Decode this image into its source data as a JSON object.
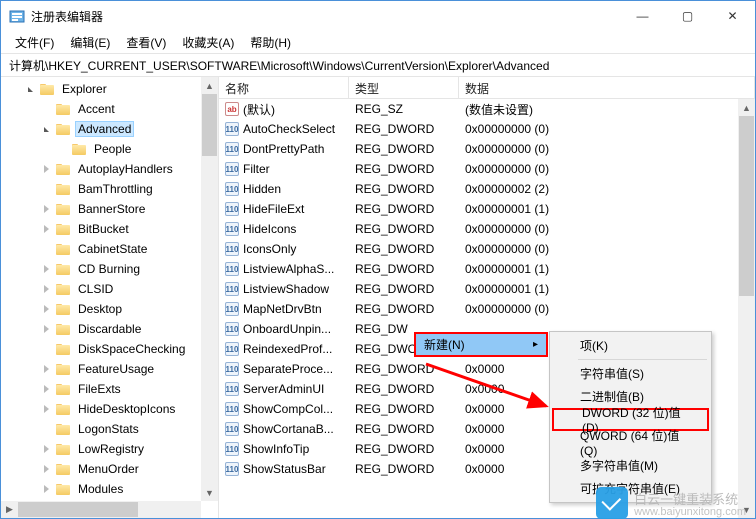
{
  "window": {
    "title": "注册表编辑器",
    "controls": {
      "min": "—",
      "max": "▢",
      "close": "✕"
    }
  },
  "menubar": {
    "file": "文件(F)",
    "edit": "编辑(E)",
    "view": "查看(V)",
    "favorites": "收藏夹(A)",
    "help": "帮助(H)"
  },
  "addressbar": "计算机\\HKEY_CURRENT_USER\\SOFTWARE\\Microsoft\\Windows\\CurrentVersion\\Explorer\\Advanced",
  "tree": {
    "items": [
      {
        "label": "Explorer",
        "depth": 1,
        "expander": "open",
        "selected": false
      },
      {
        "label": "Accent",
        "depth": 2,
        "expander": "none",
        "selected": false
      },
      {
        "label": "Advanced",
        "depth": 2,
        "expander": "open",
        "selected": true
      },
      {
        "label": "People",
        "depth": 3,
        "expander": "none",
        "selected": false
      },
      {
        "label": "AutoplayHandlers",
        "depth": 2,
        "expander": "closed",
        "selected": false
      },
      {
        "label": "BamThrottling",
        "depth": 2,
        "expander": "none",
        "selected": false
      },
      {
        "label": "BannerStore",
        "depth": 2,
        "expander": "closed",
        "selected": false
      },
      {
        "label": "BitBucket",
        "depth": 2,
        "expander": "closed",
        "selected": false
      },
      {
        "label": "CabinetState",
        "depth": 2,
        "expander": "none",
        "selected": false
      },
      {
        "label": "CD Burning",
        "depth": 2,
        "expander": "closed",
        "selected": false
      },
      {
        "label": "CLSID",
        "depth": 2,
        "expander": "closed",
        "selected": false
      },
      {
        "label": "Desktop",
        "depth": 2,
        "expander": "closed",
        "selected": false
      },
      {
        "label": "Discardable",
        "depth": 2,
        "expander": "closed",
        "selected": false
      },
      {
        "label": "DiskSpaceChecking",
        "depth": 2,
        "expander": "none",
        "selected": false
      },
      {
        "label": "FeatureUsage",
        "depth": 2,
        "expander": "closed",
        "selected": false
      },
      {
        "label": "FileExts",
        "depth": 2,
        "expander": "closed",
        "selected": false
      },
      {
        "label": "HideDesktopIcons",
        "depth": 2,
        "expander": "closed",
        "selected": false
      },
      {
        "label": "LogonStats",
        "depth": 2,
        "expander": "none",
        "selected": false
      },
      {
        "label": "LowRegistry",
        "depth": 2,
        "expander": "closed",
        "selected": false
      },
      {
        "label": "MenuOrder",
        "depth": 2,
        "expander": "closed",
        "selected": false
      },
      {
        "label": "Modules",
        "depth": 2,
        "expander": "closed",
        "selected": false
      }
    ]
  },
  "columns": {
    "name": "名称",
    "type": "类型",
    "data": "数据"
  },
  "values": [
    {
      "name": "(默认)",
      "type": "REG_SZ",
      "data": "(数值未设置)",
      "icon": "str"
    },
    {
      "name": "AutoCheckSelect",
      "type": "REG_DWORD",
      "data": "0x00000000 (0)",
      "icon": "bin"
    },
    {
      "name": "DontPrettyPath",
      "type": "REG_DWORD",
      "data": "0x00000000 (0)",
      "icon": "bin"
    },
    {
      "name": "Filter",
      "type": "REG_DWORD",
      "data": "0x00000000 (0)",
      "icon": "bin"
    },
    {
      "name": "Hidden",
      "type": "REG_DWORD",
      "data": "0x00000002 (2)",
      "icon": "bin"
    },
    {
      "name": "HideFileExt",
      "type": "REG_DWORD",
      "data": "0x00000001 (1)",
      "icon": "bin"
    },
    {
      "name": "HideIcons",
      "type": "REG_DWORD",
      "data": "0x00000000 (0)",
      "icon": "bin"
    },
    {
      "name": "IconsOnly",
      "type": "REG_DWORD",
      "data": "0x00000000 (0)",
      "icon": "bin"
    },
    {
      "name": "ListviewAlphaS...",
      "type": "REG_DWORD",
      "data": "0x00000001 (1)",
      "icon": "bin"
    },
    {
      "name": "ListviewShadow",
      "type": "REG_DWORD",
      "data": "0x00000001 (1)",
      "icon": "bin"
    },
    {
      "name": "MapNetDrvBtn",
      "type": "REG_DWORD",
      "data": "0x00000000 (0)",
      "icon": "bin"
    },
    {
      "name": "OnboardUnpin...",
      "type": "REG_DW",
      "data": "",
      "icon": "bin"
    },
    {
      "name": "ReindexedProf...",
      "type": "REG_DWORD",
      "data": "0x0000",
      "icon": "bin"
    },
    {
      "name": "SeparateProce...",
      "type": "REG_DWORD",
      "data": "0x0000",
      "icon": "bin"
    },
    {
      "name": "ServerAdminUI",
      "type": "REG_DWORD",
      "data": "0x0000",
      "icon": "bin"
    },
    {
      "name": "ShowCompCol...",
      "type": "REG_DWORD",
      "data": "0x0000",
      "icon": "bin"
    },
    {
      "name": "ShowCortanaB...",
      "type": "REG_DWORD",
      "data": "0x0000",
      "icon": "bin"
    },
    {
      "name": "ShowInfoTip",
      "type": "REG_DWORD",
      "data": "0x0000",
      "icon": "bin"
    },
    {
      "name": "ShowStatusBar",
      "type": "REG_DWORD",
      "data": "0x0000",
      "icon": "bin"
    }
  ],
  "context_menu": {
    "trigger": "新建(N)",
    "items": [
      {
        "label": "项(K)",
        "highlight": false
      },
      {
        "label": "字符串值(S)",
        "highlight": false
      },
      {
        "label": "二进制值(B)",
        "highlight": false
      },
      {
        "label": "DWORD (32 位)值(D)",
        "highlight": true
      },
      {
        "label": "QWORD (64 位)值(Q)",
        "highlight": false
      },
      {
        "label": "多字符串值(M)",
        "highlight": false
      },
      {
        "label": "可扩充字符串值(E)",
        "highlight": false
      }
    ]
  },
  "watermark": {
    "brand": "白云一键重装系统",
    "url": "www.baiyunxitong.com"
  },
  "icon_text": {
    "str": "ab",
    "bin": "110"
  },
  "arrow_char": "▸"
}
